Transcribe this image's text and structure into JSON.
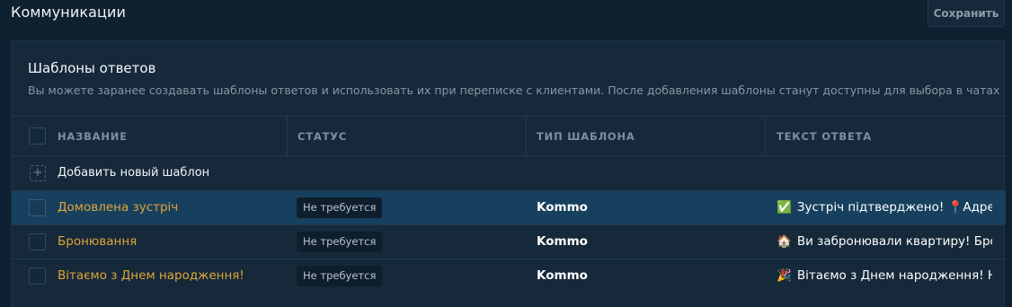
{
  "header": {
    "title": "Коммуникации",
    "save_label": "Сохранить"
  },
  "panel": {
    "title": "Шаблоны ответов",
    "description": "Вы можете заранее создавать шаблоны ответов и использовать их при переписке с клиентами. После добавления шаблоны станут доступны для выбора в чатах"
  },
  "table": {
    "columns": [
      "НАЗВАНИЕ",
      "СТАТУС",
      "ТИП ШАБЛОНА",
      "ТЕКСТ ОТВЕТА"
    ],
    "add_row_label": "Добавить новый шаблон",
    "rows": [
      {
        "name": "Домовлена зустріч",
        "status": "Не требуется",
        "type": "Kommo",
        "text_emoji": "✅",
        "text": "Зустріч підтверджено! 📍Адреса",
        "selected": true
      },
      {
        "name": "Бронювання",
        "status": "Не требуется",
        "type": "Kommo",
        "text_emoji": "🏠",
        "text": "Ви забронювали квартиру! Брон",
        "selected": false
      },
      {
        "name": "Вітаємо з Днем народження!",
        "status": "Не требуется",
        "type": "Kommo",
        "text_emoji": "🎉",
        "text": "Вітаємо з Днем народження! Не",
        "selected": false
      }
    ]
  },
  "colors": {
    "background": "#0f2030",
    "panel": "#15293a",
    "selected_row": "#17405f",
    "link_name": "#e0a43a"
  }
}
